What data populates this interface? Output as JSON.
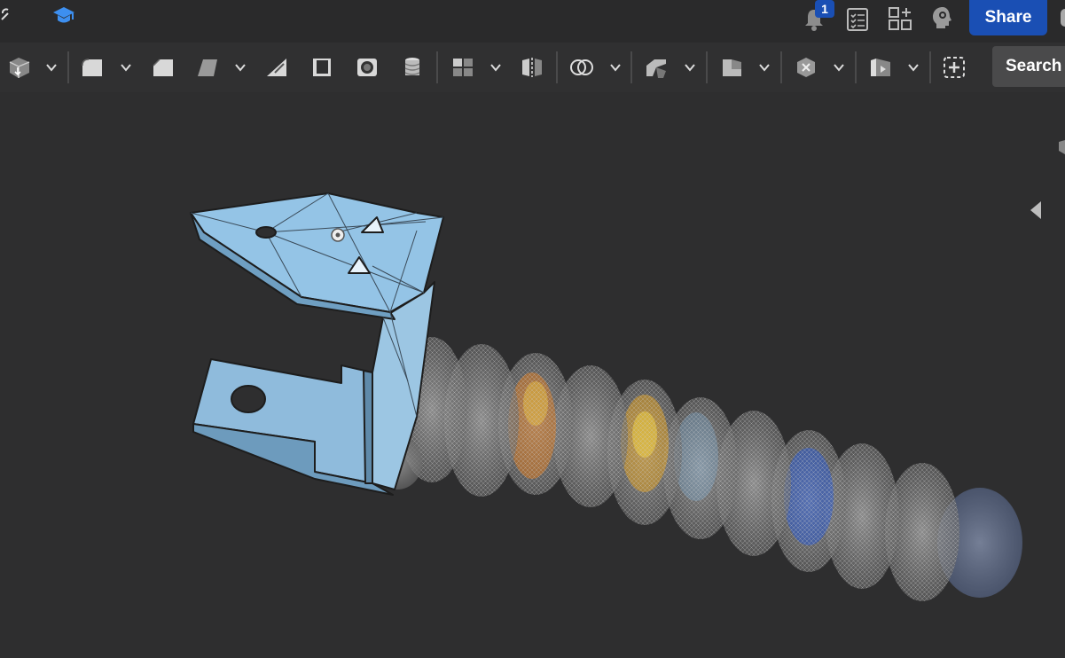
{
  "topbar": {
    "notifications": {
      "count": "1",
      "icon": "bell-icon"
    },
    "share_label": "Share",
    "icons": [
      "link-icon",
      "learning-center-icon",
      "bell-icon",
      "checklist-icon",
      "app-store-icon",
      "user-avatar-icon"
    ]
  },
  "toolbar": {
    "search_label": "Search",
    "tools": [
      "derive-icon",
      "fillet-icon",
      "chamfer-icon",
      "draft-icon",
      "rib-icon",
      "shell-icon",
      "hole-icon",
      "thread-icon",
      "pattern-icon",
      "mirror-icon",
      "boolean-icon",
      "split-icon",
      "transform-icon",
      "delete-part-icon",
      "sheet-metal-icon",
      "insert-feature-icon"
    ]
  },
  "viewport": {
    "part_color": "#94c4e6",
    "body_color": "#8a8a8a"
  }
}
